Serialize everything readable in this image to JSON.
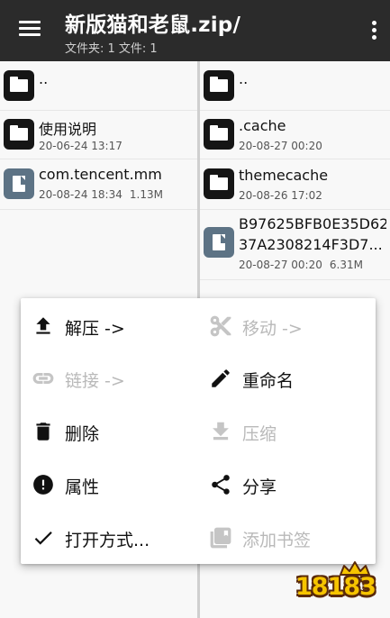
{
  "appbar": {
    "title": "新版猫和老鼠.zip/",
    "subtitle": "文件夹: 1  文件: 1"
  },
  "left_pane": {
    "items": [
      {
        "name": "..",
        "type": "folder",
        "date": "",
        "size": ""
      },
      {
        "name": "使用说明",
        "type": "folder",
        "date": "20-06-24 13:17",
        "size": ""
      },
      {
        "name": "com.tencent.mm",
        "type": "file",
        "date": "20-08-24 18:34",
        "size": "1.13M"
      }
    ]
  },
  "right_pane": {
    "items": [
      {
        "name": "..",
        "type": "folder",
        "date": "",
        "size": ""
      },
      {
        "name": ".cache",
        "type": "folder",
        "date": "20-08-27 00:20",
        "size": ""
      },
      {
        "name": "themecache",
        "type": "folder",
        "date": "20-08-26 17:02",
        "size": ""
      },
      {
        "name_line1": "B97625BFB0E35D62",
        "name_line2": "37A2308214F3D7...",
        "type": "file",
        "date": "20-08-27 00:20",
        "size": "6.31M"
      }
    ]
  },
  "actions": {
    "extract": {
      "label": "解压 ->",
      "icon": "upload-icon",
      "enabled": true
    },
    "move": {
      "label": "移动 ->",
      "icon": "scissors-icon",
      "enabled": false
    },
    "link": {
      "label": "链接 ->",
      "icon": "link-icon",
      "enabled": false
    },
    "rename": {
      "label": "重命名",
      "icon": "pencil-icon",
      "enabled": true
    },
    "delete": {
      "label": "删除",
      "icon": "trash-icon",
      "enabled": true
    },
    "compress": {
      "label": "压缩",
      "icon": "download-icon",
      "enabled": false
    },
    "properties": {
      "label": "属性",
      "icon": "info-icon",
      "enabled": true
    },
    "share": {
      "label": "分享",
      "icon": "share-icon",
      "enabled": true
    },
    "open_with": {
      "label": "打开方式...",
      "icon": "check-icon",
      "enabled": true
    },
    "bookmark": {
      "label": "添加书签",
      "icon": "bookmark-icon",
      "enabled": false
    }
  },
  "watermark": {
    "text": "18183"
  },
  "colors": {
    "appbar": "#2b2b2b",
    "folder_icon": "#151515",
    "file_icon": "#5d7385",
    "disabled_text": "#b9b9b9",
    "watermark_fill": "#f6c400"
  }
}
